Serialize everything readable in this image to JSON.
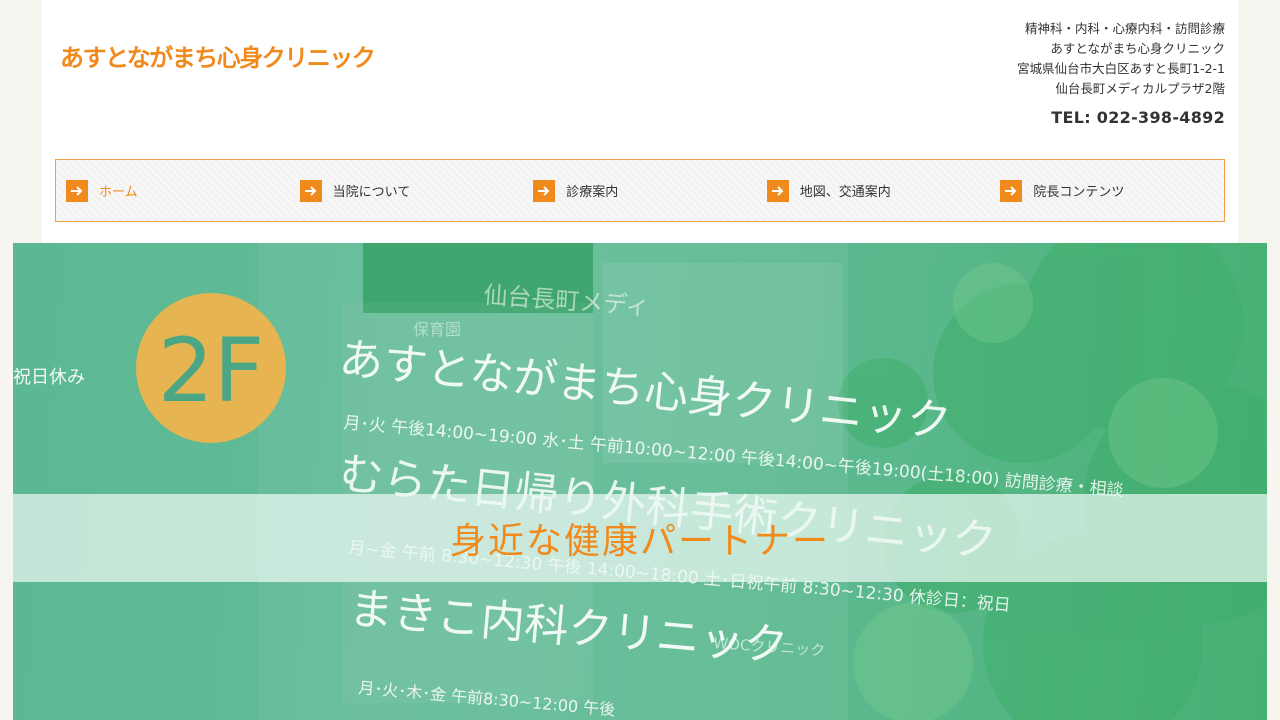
{
  "header": {
    "logo_text": "あすとながまち心身クリニック",
    "info_lines": [
      "精神科・内科・心療内科・訪問診療",
      "あすとながまち心身クリニック",
      "宮城県仙台市大白区あすと長町1-2-1",
      "仙台長町メディカルプラザ2階"
    ],
    "tel": "TEL: 022-398-4892"
  },
  "nav": {
    "items": [
      {
        "label": "ホーム",
        "active": true
      },
      {
        "label": "当院について",
        "active": false
      },
      {
        "label": "診療案内",
        "active": false
      },
      {
        "label": "地図、交通案内",
        "active": false
      },
      {
        "label": "院長コンテンツ",
        "active": false
      }
    ]
  },
  "hero": {
    "tagline": "身近な健康パートナー",
    "photo_sign": {
      "floor_badge": "2F",
      "building_name": "仙台長町メディ",
      "holiday_note": "祝日休み",
      "clinic_1": "あすとながまち心身クリニック",
      "hours_1": "月･火 午後14:00~19:00 水･土 午前10:00~12:00 午後14:00~午後19:00(土18:00) 訪問診療・相談",
      "clinic_2": "むらた日帰り外科手術クリニック",
      "hours_2": "月~金 午前 8:30~12:30 午後 14:00~18:00 土･日祝午前 8:30~12:30 休診日：祝日",
      "clinic_3": "まきこ内科クリニック",
      "hours_3": "月･火･木･金 午前8:30~12:00 午後",
      "nursery": "保育園",
      "small_sign": "WOCクリニック"
    }
  },
  "colors": {
    "accent": "#f08a1c",
    "hero_green": "#5cb894",
    "band": "#ecf8f2"
  }
}
